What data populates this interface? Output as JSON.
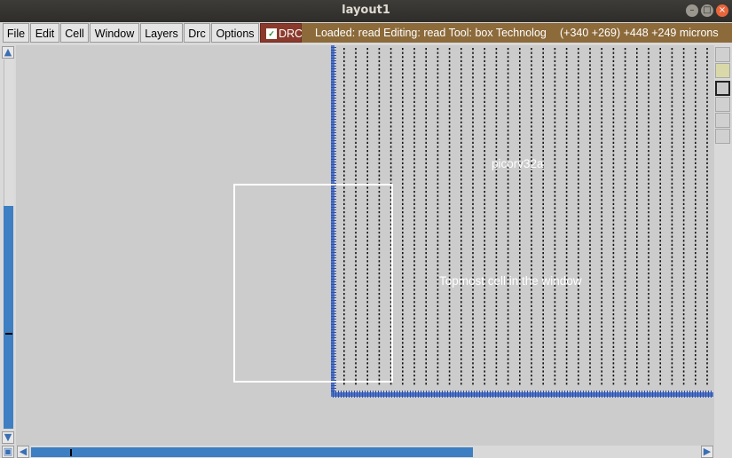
{
  "window": {
    "title": "layout1"
  },
  "menu": {
    "items": [
      {
        "label": "File",
        "name": "menu-file"
      },
      {
        "label": "Edit",
        "name": "menu-edit"
      },
      {
        "label": "Cell",
        "name": "menu-cell"
      },
      {
        "label": "Window",
        "name": "menu-window"
      },
      {
        "label": "Layers",
        "name": "menu-layers"
      },
      {
        "label": "Drc",
        "name": "menu-drc"
      },
      {
        "label": "Options",
        "name": "menu-options"
      }
    ],
    "drc_toggle": {
      "label": "DRC",
      "checked": true
    }
  },
  "status": {
    "message": "Loaded: read Editing: read Tool: box  Technology",
    "coords": "(+340 +269) +448 +249 microns"
  },
  "canvas": {
    "cell_label": "picorv32a",
    "cell_description": "Topmost cell in the window"
  },
  "icons": {
    "scroll_up": "arrow-up-icon",
    "scroll_down": "arrow-down-icon",
    "scroll_left": "arrow-left-icon",
    "scroll_right": "arrow-right-icon",
    "zoom_box": "zoom-box-icon"
  },
  "colors": {
    "drc_bg": "#8a3a2c",
    "status_bg": "#8c6a3a",
    "scroll_thumb": "#3d7fc2",
    "layout_bg": "#cccccc"
  }
}
